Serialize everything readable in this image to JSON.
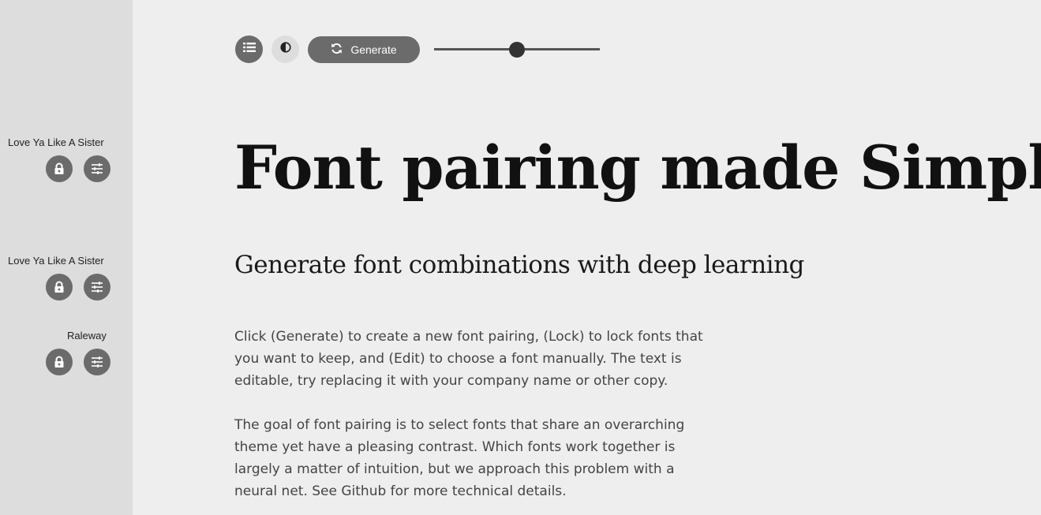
{
  "sidebar": {
    "fonts": [
      {
        "name": "Love Ya Like A Sister",
        "lock_icon": "lock-icon",
        "edit_icon": "sliders-icon"
      },
      {
        "name": "Love Ya Like A Sister",
        "lock_icon": "lock-icon",
        "edit_icon": "sliders-icon"
      },
      {
        "name": "Raleway",
        "lock_icon": "lock-icon",
        "edit_icon": "sliders-icon"
      }
    ]
  },
  "toolbar": {
    "list_icon": "list-icon",
    "contrast_icon": "contrast-icon",
    "generate_icon": "refresh-icon",
    "generate_label": "Generate",
    "slider_value": 0.5
  },
  "main": {
    "headline": "Font pairing made Simple",
    "subheadline": "Generate font combinations with deep learning",
    "paragraph1": "Click (Generate) to create a new font pairing, (Lock) to lock fonts that you want to keep, and (Edit) to choose a font manually. The text is editable, try replacing it with your company name or other copy.",
    "paragraph2": "The goal of font pairing is to select fonts that share an overarching theme yet have a pleasing contrast. Which fonts work together is largely a matter of intuition, but we approach this problem with a neural net. See Github for more technical details."
  },
  "colors": {
    "sidebar_bg": "#dddddd",
    "page_bg": "#eeeeee",
    "button_gray": "#6b6b6b"
  }
}
